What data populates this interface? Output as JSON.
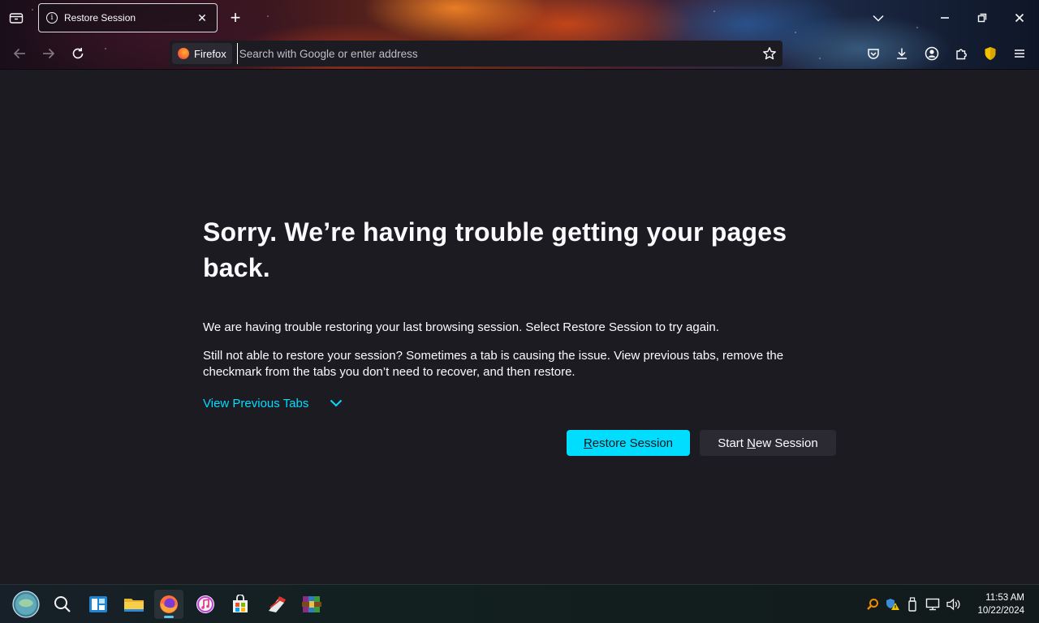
{
  "browser": {
    "tab": {
      "title": "Restore Session",
      "close_glyph": "✕"
    },
    "new_tab_glyph": "+",
    "identity_label": "Firefox",
    "url_placeholder": "Search with Google or enter address"
  },
  "page": {
    "heading": "Sorry. We’re having trouble getting your pages back.",
    "paragraph1": "We are having trouble restoring your last browsing session. Select Restore Session to try again.",
    "paragraph2": "Still not able to restore your session? Sometimes a tab is causing the issue. View previous tabs, remove the checkmark from the tabs you don’t need to recover, and then restore.",
    "view_previous_tabs": "View Previous Tabs",
    "restore_button": {
      "accesskey": "R",
      "rest": "estore Session"
    },
    "new_session_button": {
      "before": "Start ",
      "accesskey": "N",
      "after": "ew Session"
    }
  },
  "taskbar": {
    "apps": [
      "start-icon",
      "search-icon",
      "widgets-icon",
      "file-explorer-icon",
      "firefox-icon",
      "itunes-icon",
      "store-icon",
      "ccleaner-icon",
      "winrar-icon"
    ],
    "active_app": "firefox-icon",
    "clock": {
      "time": "11:53 AM",
      "date": "10/22/2024"
    }
  },
  "colors": {
    "accent": "#00ddff",
    "page_bg": "#1c1b22",
    "button_secondary": "#2b2a33"
  }
}
